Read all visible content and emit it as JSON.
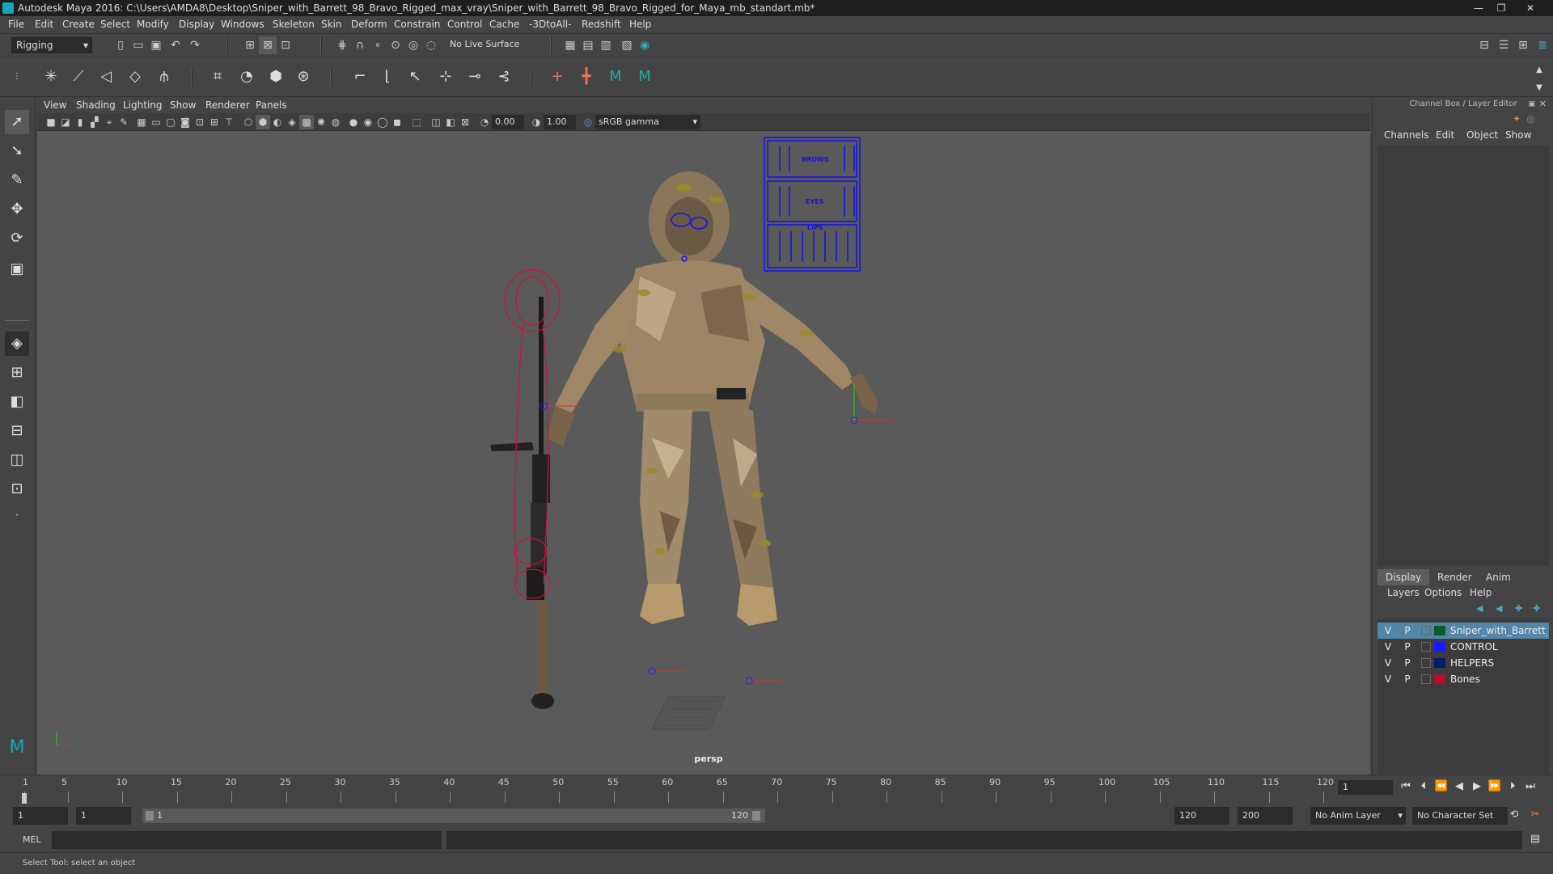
{
  "window": {
    "title": "Autodesk Maya 2016: C:\\Users\\AMDA8\\Desktop\\Sniper_with_Barrett_98_Bravo_Rigged_max_vray\\Sniper_with_Barrett_98_Bravo_Rigged_for_Maya_mb_standart.mb*",
    "minimize": "—",
    "maximize": "❐",
    "close": "✕"
  },
  "menubar": [
    "File",
    "Edit",
    "Create",
    "Select",
    "Modify",
    "Display",
    "Windows",
    "Skeleton",
    "Skin",
    "Deform",
    "Constrain",
    "Control",
    "Cache",
    "-3DtoAll-",
    "Redshift",
    "Help"
  ],
  "status_line": {
    "mode": "Rigging",
    "live_surface": "No Live Surface"
  },
  "viewport": {
    "menu": [
      "View",
      "Shading",
      "Lighting",
      "Show",
      "Renderer",
      "Panels"
    ],
    "exposure": "0.00",
    "gamma": "1.00",
    "color_space": "sRGB gamma",
    "camera_label": "persp",
    "control_panel_labels": [
      "BROWS",
      "EYES",
      "LIPS"
    ]
  },
  "channel_box": {
    "title": "Channel Box / Layer Editor",
    "tabs": [
      "Channels",
      "Edit",
      "Object",
      "Show"
    ]
  },
  "layer_editor": {
    "tabs": [
      "Display",
      "Render",
      "Anim"
    ],
    "active_tab": "Display",
    "menu": [
      "Layers",
      "Options",
      "Help"
    ],
    "layers": [
      {
        "v": "V",
        "p": "P",
        "color": "#0a5a2a",
        "name": "Sniper_with_Barrett_98",
        "selected": true
      },
      {
        "v": "V",
        "p": "P",
        "color": "#1a1aff",
        "name": "CONTROL",
        "selected": false
      },
      {
        "v": "V",
        "p": "P",
        "color": "#0a1a6a",
        "name": "HELPERS",
        "selected": false
      },
      {
        "v": "V",
        "p": "P",
        "color": "#b01030",
        "name": "Bones",
        "selected": false
      }
    ]
  },
  "timeline": {
    "ticks": [
      1,
      5,
      10,
      15,
      20,
      25,
      30,
      35,
      40,
      45,
      50,
      55,
      60,
      65,
      70,
      75,
      80,
      85,
      90,
      95,
      100,
      105,
      110,
      115,
      120
    ],
    "current_frame": "1"
  },
  "range": {
    "start": "1",
    "playback_start": "1",
    "range_start_label": "1",
    "range_end_label": "120",
    "playback_end": "120",
    "end": "200",
    "anim_layer": "No Anim Layer",
    "character_set": "No Character Set"
  },
  "command_line": {
    "label": "MEL"
  },
  "help_line": "Select Tool: select an object"
}
